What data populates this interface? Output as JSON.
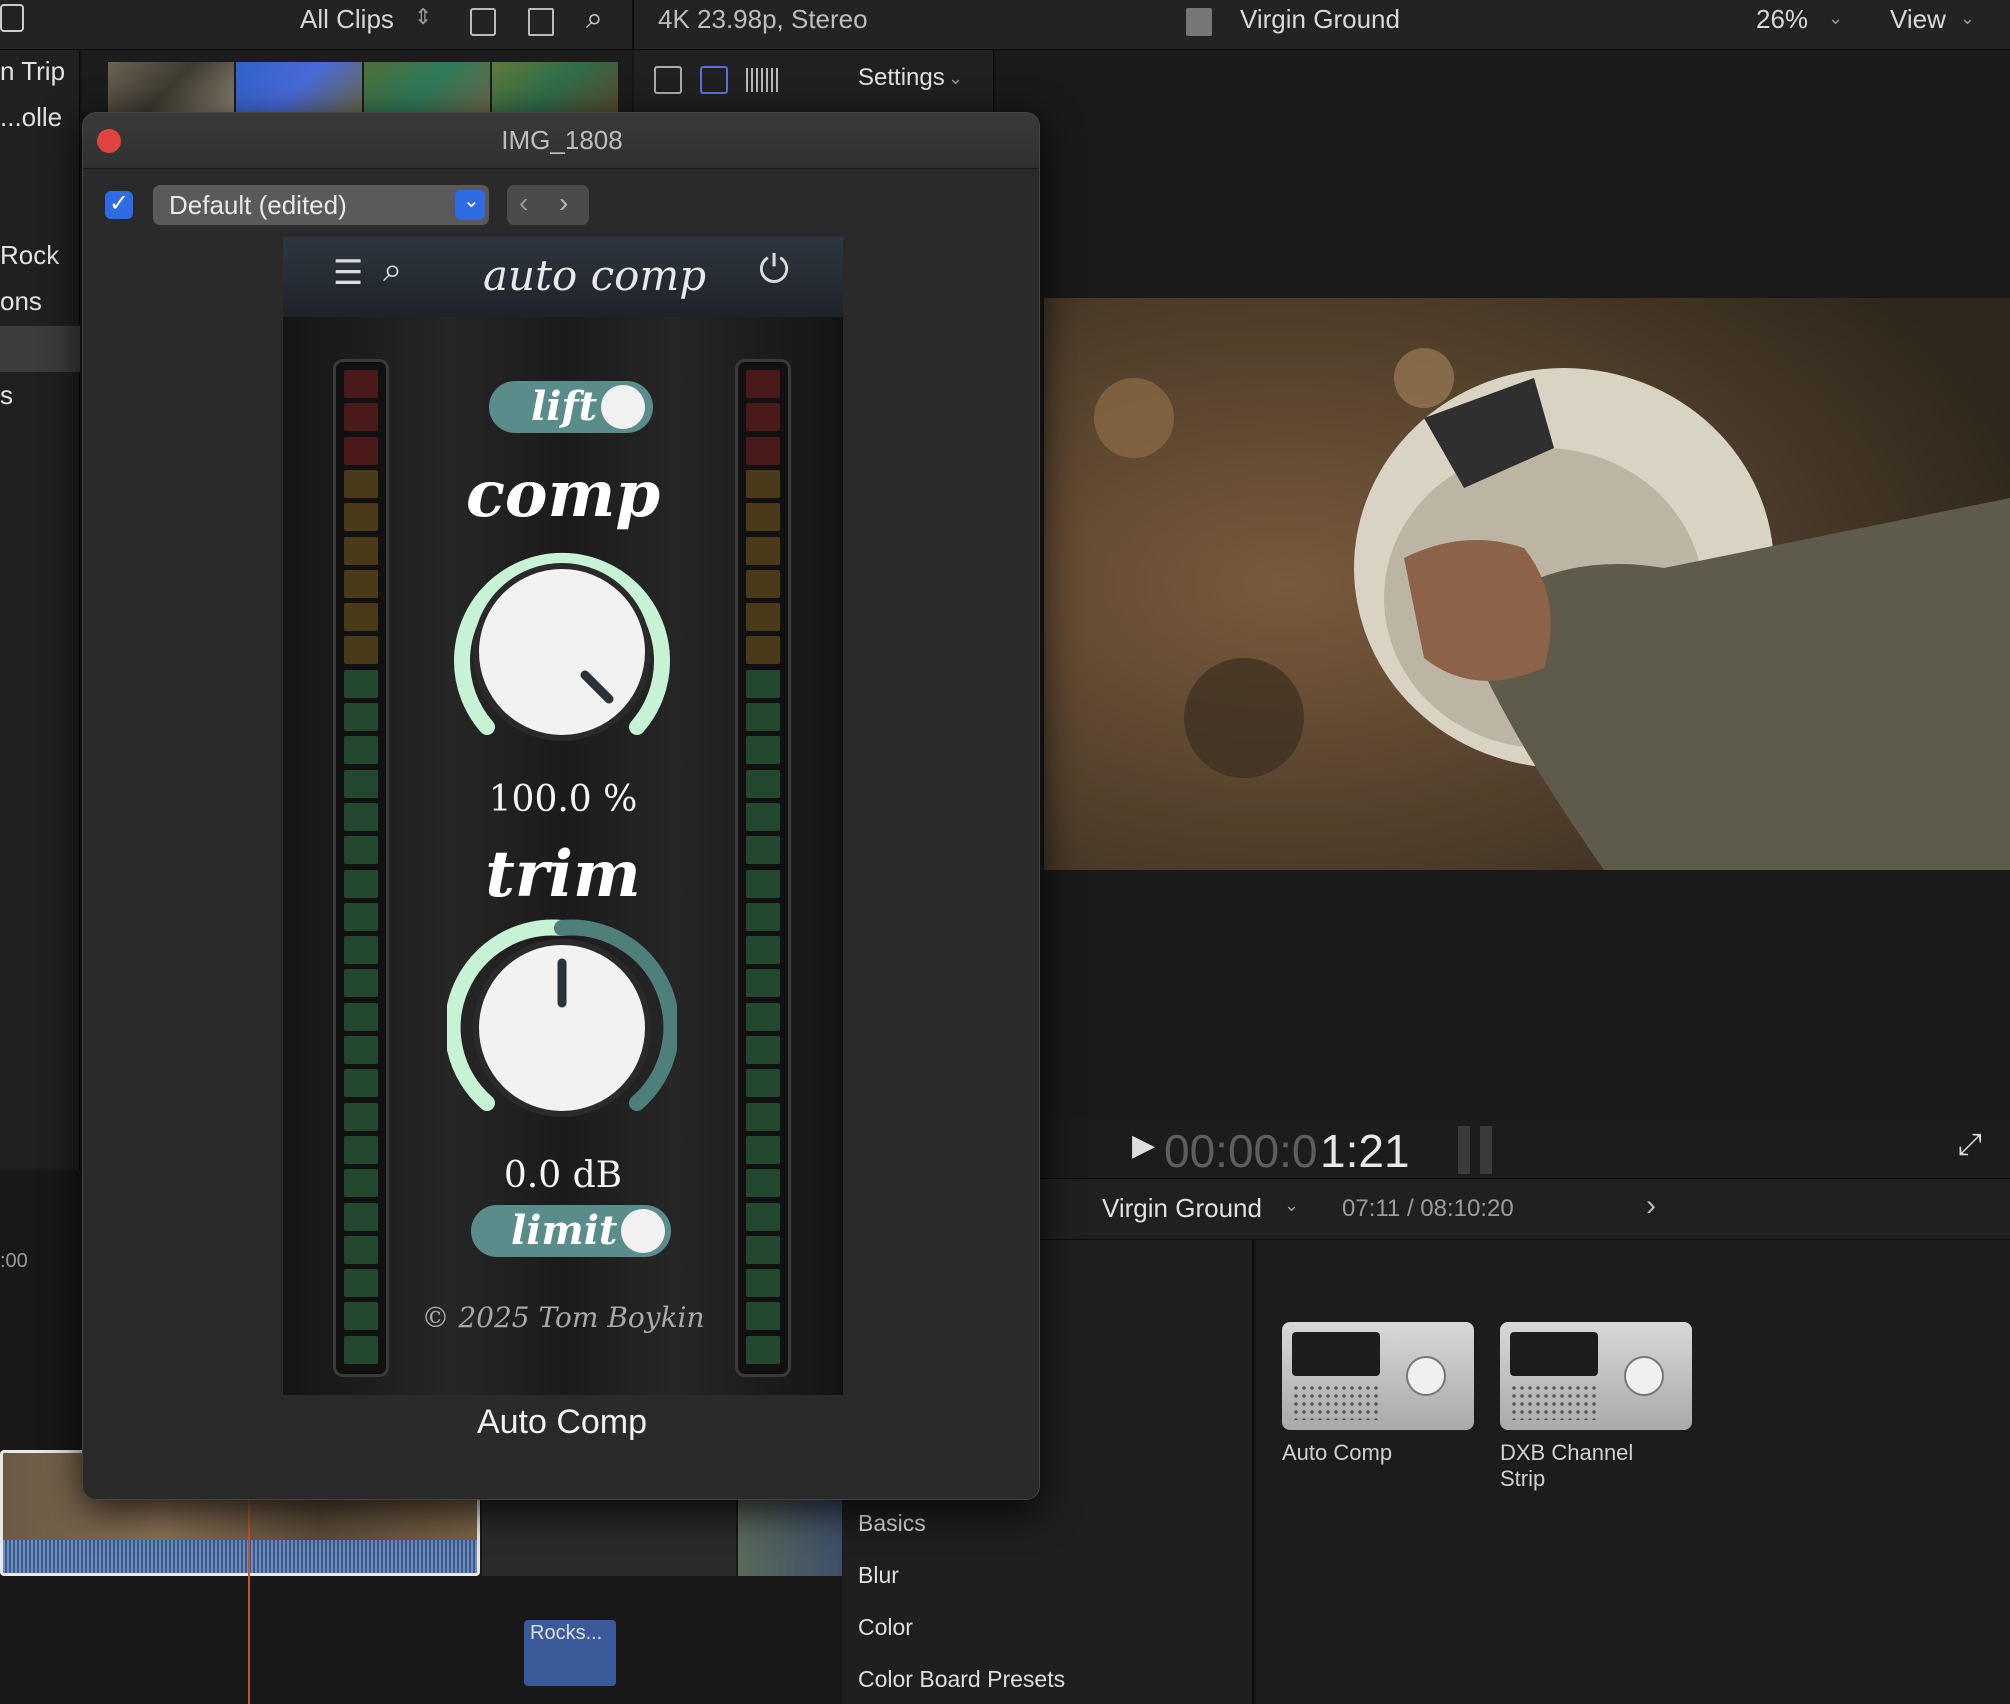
{
  "topbar": {
    "clips_filter": "All Clips",
    "format": "4K 23.98p, Stereo",
    "project": "Virgin Ground",
    "zoom": "26%",
    "view": "View"
  },
  "sidebar": {
    "items": [
      "n Trip",
      "olle...",
      "Rock",
      "ons",
      "s"
    ]
  },
  "inspector": {
    "settings_label": "Settings"
  },
  "plugin_window": {
    "title": "IMG_1808",
    "preset": "Default (edited)",
    "enabled": true,
    "plugin_name": "Auto Comp",
    "header_title": "auto comp",
    "lift_label": "lift",
    "comp_label": "comp",
    "comp_value": "100.0 %",
    "comp_level": 1.0,
    "trim_label": "trim",
    "trim_value": "0.0 dB",
    "limit_label": "limit",
    "copyright": "© 2025 Tom Boykin"
  },
  "viewer": {
    "timecode_dim": "00:00:0",
    "timecode_bright": "1:21"
  },
  "timeline": {
    "project": "Virgin Ground",
    "position": "07:11 / 08:10:20",
    "ruler_mark": ":00",
    "clip_label": "Rocks..."
  },
  "effects": {
    "categories": [
      "Basics",
      "Blur",
      "Color",
      "Color Board Presets"
    ],
    "items": [
      {
        "name": "Auto Comp"
      },
      {
        "name": "DXB Channel Strip"
      }
    ]
  },
  "colors": {
    "accent": "#2f6be4",
    "close": "#e0443e",
    "toggle": "#5b8c8c",
    "knob_arc": "#c7f2d6",
    "meter_green": "#24472f",
    "meter_amber": "#4a3a19",
    "meter_red": "#4a1a1a"
  }
}
